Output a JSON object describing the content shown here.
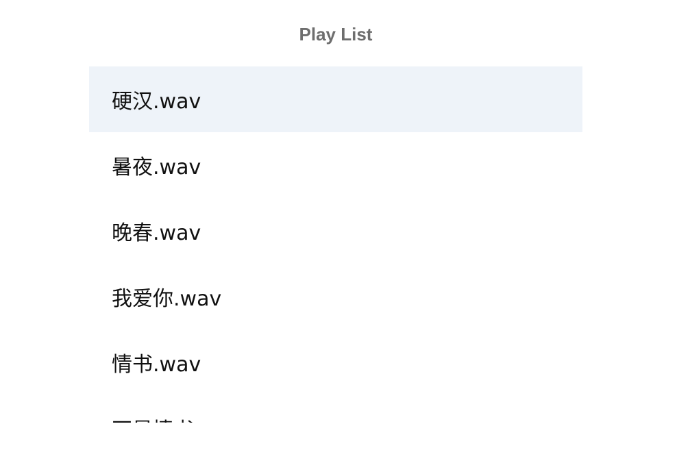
{
  "header": {
    "title": "Play List"
  },
  "playlist": {
    "selected_index": 0,
    "items": [
      {
        "label": "硬汉.wav"
      },
      {
        "label": "暑夜.wav"
      },
      {
        "label": "晚春.wav"
      },
      {
        "label": "我爱你.wav"
      },
      {
        "label": "情书.wav"
      },
      {
        "label": "不是情书.wav"
      }
    ]
  },
  "colors": {
    "selected_row_background": "#eef3f9",
    "title_text": "#6e6e6e",
    "item_text": "#111111",
    "background": "#ffffff"
  }
}
